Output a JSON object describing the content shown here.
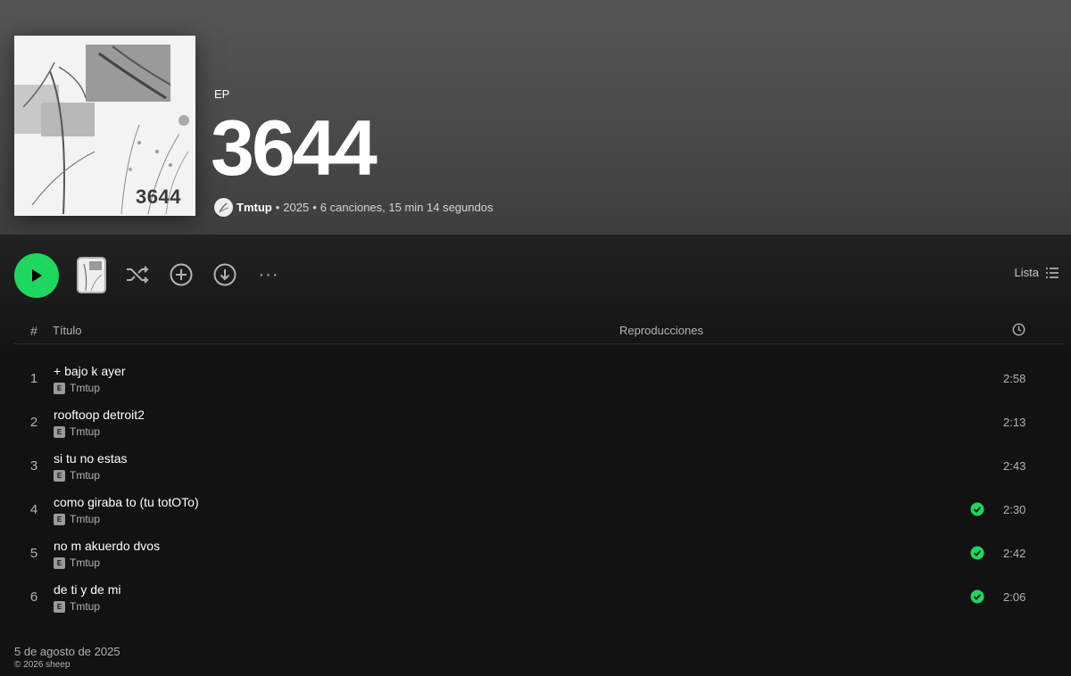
{
  "album": {
    "cover_title": "3644",
    "type": "EP",
    "title": "3644",
    "artist": "Tmtup",
    "year": "2025",
    "summary": "6 canciones, 15 min 14 segundos",
    "separator": "•"
  },
  "controls": {
    "more_label": "···",
    "view_label": "Lista"
  },
  "table_header": {
    "number": "#",
    "title": "Título",
    "plays": "Reproducciones"
  },
  "tracks": [
    {
      "number": "1",
      "title": "+ bajo k ayer",
      "artist": "Tmtup",
      "explicit": "E",
      "downloaded": false,
      "duration": "2:58"
    },
    {
      "number": "2",
      "title": "rooftoop detroit2",
      "artist": "Tmtup",
      "explicit": "E",
      "downloaded": false,
      "duration": "2:13"
    },
    {
      "number": "3",
      "title": "si tu no estas",
      "artist": "Tmtup",
      "explicit": "E",
      "downloaded": false,
      "duration": "2:43"
    },
    {
      "number": "4",
      "title": "como giraba to (tu totOTo)",
      "artist": "Tmtup",
      "explicit": "E",
      "downloaded": true,
      "duration": "2:30"
    },
    {
      "number": "5",
      "title": "no m akuerdo dvos",
      "artist": "Tmtup",
      "explicit": "E",
      "downloaded": true,
      "duration": "2:42"
    },
    {
      "number": "6",
      "title": "de ti y de mi",
      "artist": "Tmtup",
      "explicit": "E",
      "downloaded": true,
      "duration": "2:06"
    }
  ],
  "footer": {
    "release_date": "5 de agosto de 2025",
    "copyright": "© 2026 sheep"
  },
  "colors": {
    "accent": "#1ed760",
    "background": "#121212",
    "hero": "#535353"
  }
}
